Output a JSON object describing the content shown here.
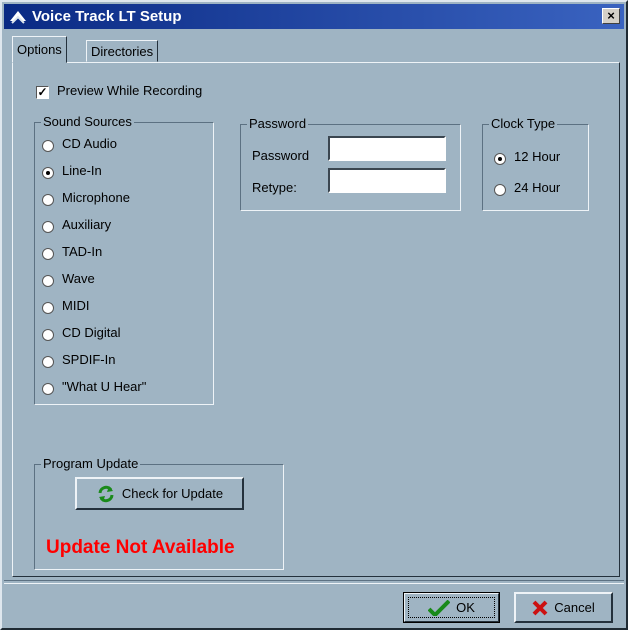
{
  "window": {
    "title": "Voice Track LT Setup",
    "close_label": "×"
  },
  "tabs": [
    {
      "label": "Options",
      "active": true
    },
    {
      "label": "Directories",
      "active": false
    }
  ],
  "options": {
    "preview_label": "Preview While Recording",
    "preview_checked": true
  },
  "sound_sources": {
    "legend": "Sound Sources",
    "items": [
      {
        "label": "CD Audio",
        "selected": false
      },
      {
        "label": "Line-In",
        "selected": true
      },
      {
        "label": "Microphone",
        "selected": false
      },
      {
        "label": "Auxiliary",
        "selected": false
      },
      {
        "label": "TAD-In",
        "selected": false
      },
      {
        "label": "Wave",
        "selected": false
      },
      {
        "label": "MIDI",
        "selected": false
      },
      {
        "label": "CD Digital",
        "selected": false
      },
      {
        "label": "SPDIF-In",
        "selected": false
      },
      {
        "label": "\"What U Hear\"",
        "selected": false
      }
    ]
  },
  "password": {
    "legend": "Password",
    "password_label": "Password",
    "password_value": "",
    "retype_label": "Retype:",
    "retype_value": ""
  },
  "clock_type": {
    "legend": "Clock Type",
    "options": [
      {
        "label": "12 Hour",
        "selected": true
      },
      {
        "label": "24 Hour",
        "selected": false
      }
    ]
  },
  "program_update": {
    "legend": "Program Update",
    "check_button": "Check for Update",
    "status": "Update Not Available"
  },
  "footer": {
    "ok_label": "OK",
    "cancel_label": "Cancel"
  },
  "colors": {
    "status_text": "#ff0000",
    "dialog_bg": "#9fb4c3",
    "title_bar": "#0a2a84"
  }
}
